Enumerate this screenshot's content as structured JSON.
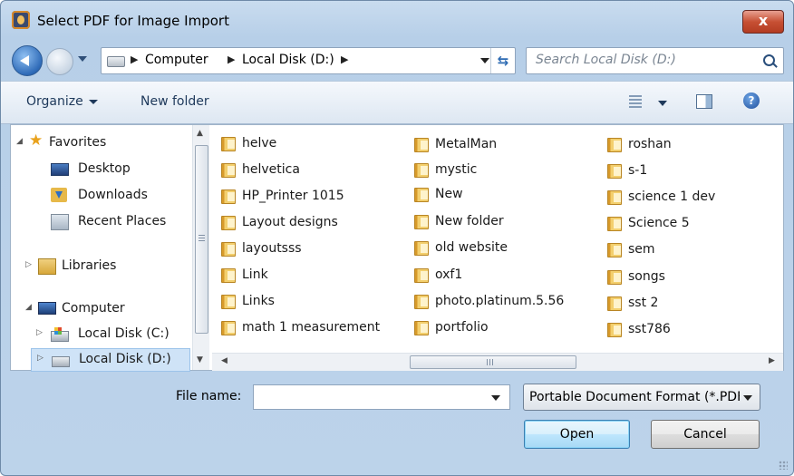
{
  "window": {
    "title": "Select PDF for Image Import",
    "close_label": "x"
  },
  "nav": {
    "breadcrumb": [
      "Computer",
      "Local Disk (D:)"
    ],
    "search_placeholder": "Search Local Disk (D:)"
  },
  "toolbar": {
    "organize_label": "Organize",
    "new_folder_label": "New folder",
    "help_label": "?"
  },
  "sidebar": {
    "favorites": "Favorites",
    "desktop": "Desktop",
    "downloads": "Downloads",
    "recent_places": "Recent Places",
    "libraries": "Libraries",
    "computer": "Computer",
    "local_disk_c": "Local Disk (C:)",
    "local_disk_d": "Local Disk (D:)"
  },
  "files": {
    "col1": [
      "helve",
      "helvetica",
      "HP_Printer 1015",
      "Layout designs",
      "layoutsss",
      "Link",
      "Links",
      "math 1 measurement"
    ],
    "col2": [
      "MetalMan",
      "mystic",
      "New",
      "New folder",
      "old website",
      "oxf1",
      "photo.platinum.5.56",
      "portfolio"
    ],
    "col3": [
      "roshan",
      "s-1",
      "science 1 dev",
      "Science 5",
      "sem",
      "songs",
      "sst 2",
      "sst786"
    ]
  },
  "footer": {
    "file_name_label": "File name:",
    "file_name_value": "",
    "file_type_value": "Portable Document Format (*.PDF)",
    "open_label": "Open",
    "cancel_label": "Cancel"
  },
  "icons": {
    "back": "back-arrow-icon",
    "forward": "forward-arrow-icon",
    "refresh": "refresh-icon",
    "search": "search-icon",
    "views": "views-icon",
    "preview": "preview-pane-icon",
    "help": "help-icon",
    "folder": "folder-icon"
  }
}
